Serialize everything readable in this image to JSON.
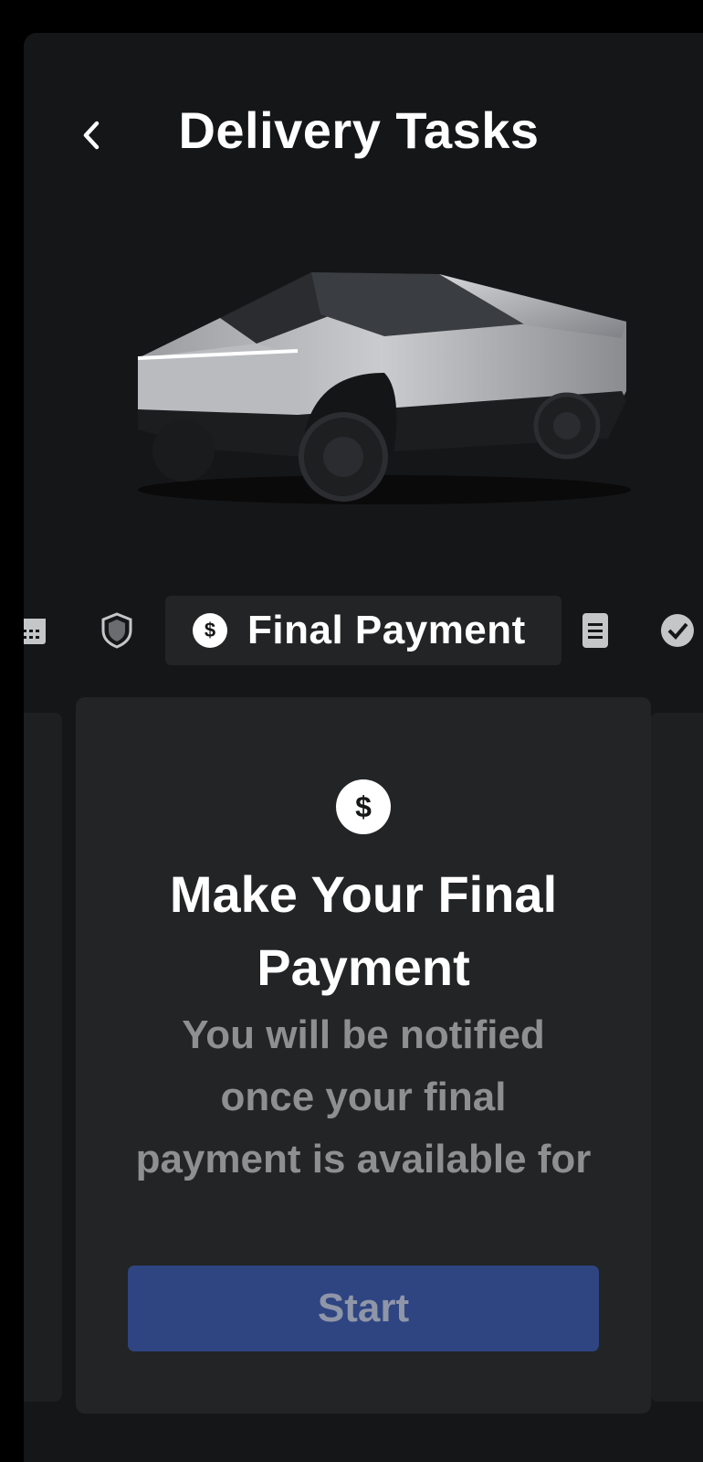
{
  "header": {
    "title": "Delivery Tasks",
    "back_icon": "chevron-left-icon"
  },
  "vehicle": {
    "image_description_icon": "cybertruck-image"
  },
  "tasks": {
    "icons": [
      "calendar-icon",
      "shield-icon",
      "dollar-icon",
      "document-icon",
      "check-circle-icon"
    ],
    "active_label": "Final Payment"
  },
  "card": {
    "icon_text": "$",
    "title_line1": "Make Your Final",
    "title_line2": "Payment",
    "desc_line1": "You will be notified",
    "desc_line2": "once your final",
    "desc_line3": "payment is available for",
    "button_label": "Start"
  },
  "colors": {
    "background": "#151617",
    "card": "#232425",
    "button": "#2e4582"
  }
}
